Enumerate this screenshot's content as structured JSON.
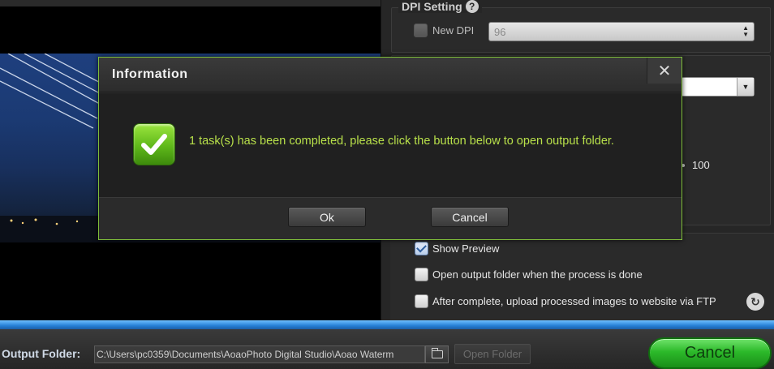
{
  "dpi_setting": {
    "title": "DPI Setting",
    "help_icon": "?",
    "new_dpi_label": "New DPI",
    "new_dpi_checked": false,
    "dpi_value": "96"
  },
  "format_section": {
    "quality_value": "100"
  },
  "options": {
    "show_preview_label": "Show Preview",
    "show_preview_checked": true,
    "open_output_label": "Open output folder when the process is done",
    "open_output_checked": false,
    "upload_ftp_label": "After complete, upload processed images to website via FTP",
    "upload_ftp_checked": false
  },
  "bottom_bar": {
    "output_folder_label": "Output Folder:",
    "output_path": "C:\\Users\\pc0359\\Documents\\AoaoPhoto Digital Studio\\Aoao Waterm",
    "open_folder_label": "Open Folder",
    "cancel_label": "Cancel"
  },
  "dialog": {
    "title": "Information",
    "close_glyph": "✕",
    "message": "1 task(s) has been completed, please click the button below to open output folder.",
    "ok_label": "Ok",
    "cancel_label": "Cancel"
  },
  "colors": {
    "dialog_border": "#7fbf3a",
    "message_text": "#b8e04a",
    "accent_blue": "#2680d6",
    "cancel_green": "#2cb92a"
  }
}
